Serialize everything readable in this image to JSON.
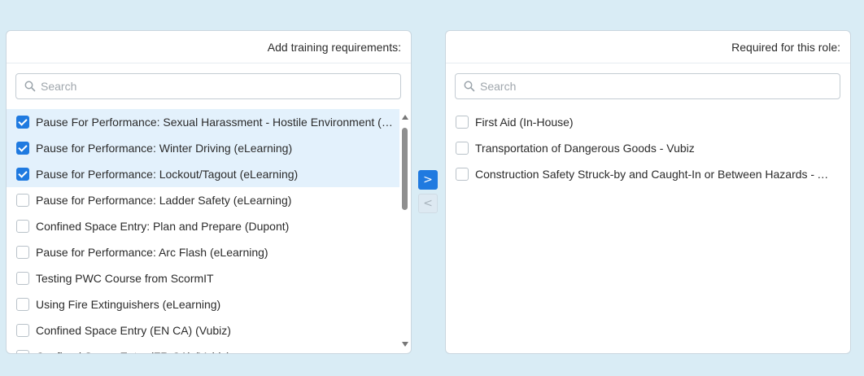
{
  "available": {
    "header": "Add training requirements:",
    "search_placeholder": "Search",
    "items": [
      {
        "label": "Pause For Performance: Sexual Harassment - Hostile Environment (eL...",
        "checked": true
      },
      {
        "label": "Pause for Performance: Winter Driving (eLearning)",
        "checked": true
      },
      {
        "label": "Pause for Performance: Lockout/Tagout (eLearning)",
        "checked": true
      },
      {
        "label": "Pause for Performance: Ladder Safety (eLearning)",
        "checked": false
      },
      {
        "label": "Confined Space Entry: Plan and Prepare (Dupont)",
        "checked": false
      },
      {
        "label": "Pause for Performance: Arc Flash (eLearning)",
        "checked": false
      },
      {
        "label": "Testing PWC Course from ScormIT",
        "checked": false
      },
      {
        "label": "Using Fire Extinguishers (eLearning)",
        "checked": false
      },
      {
        "label": "Confined Space Entry (EN CA) (Vubiz)",
        "checked": false
      },
      {
        "label": "Confined Space Entry (FR CA) (Vubiz)",
        "checked": false
      }
    ]
  },
  "required": {
    "header": "Required for this role:",
    "search_placeholder": "Search",
    "items": [
      {
        "label": "First Aid (In-House)",
        "checked": false
      },
      {
        "label": "Transportation of Dangerous Goods - Vubiz",
        "checked": false
      },
      {
        "label": "Construction Safety Struck-by and Caught-In or Between Hazards - Atl...",
        "checked": false
      }
    ]
  },
  "controls": {
    "move_right_icon": ">",
    "move_left_icon": "<",
    "move_right_color": "#1f7ae0"
  },
  "icons": {
    "search": "search-icon",
    "arrow_right": "chevron-right-icon",
    "arrow_left": "chevron-left-icon"
  }
}
